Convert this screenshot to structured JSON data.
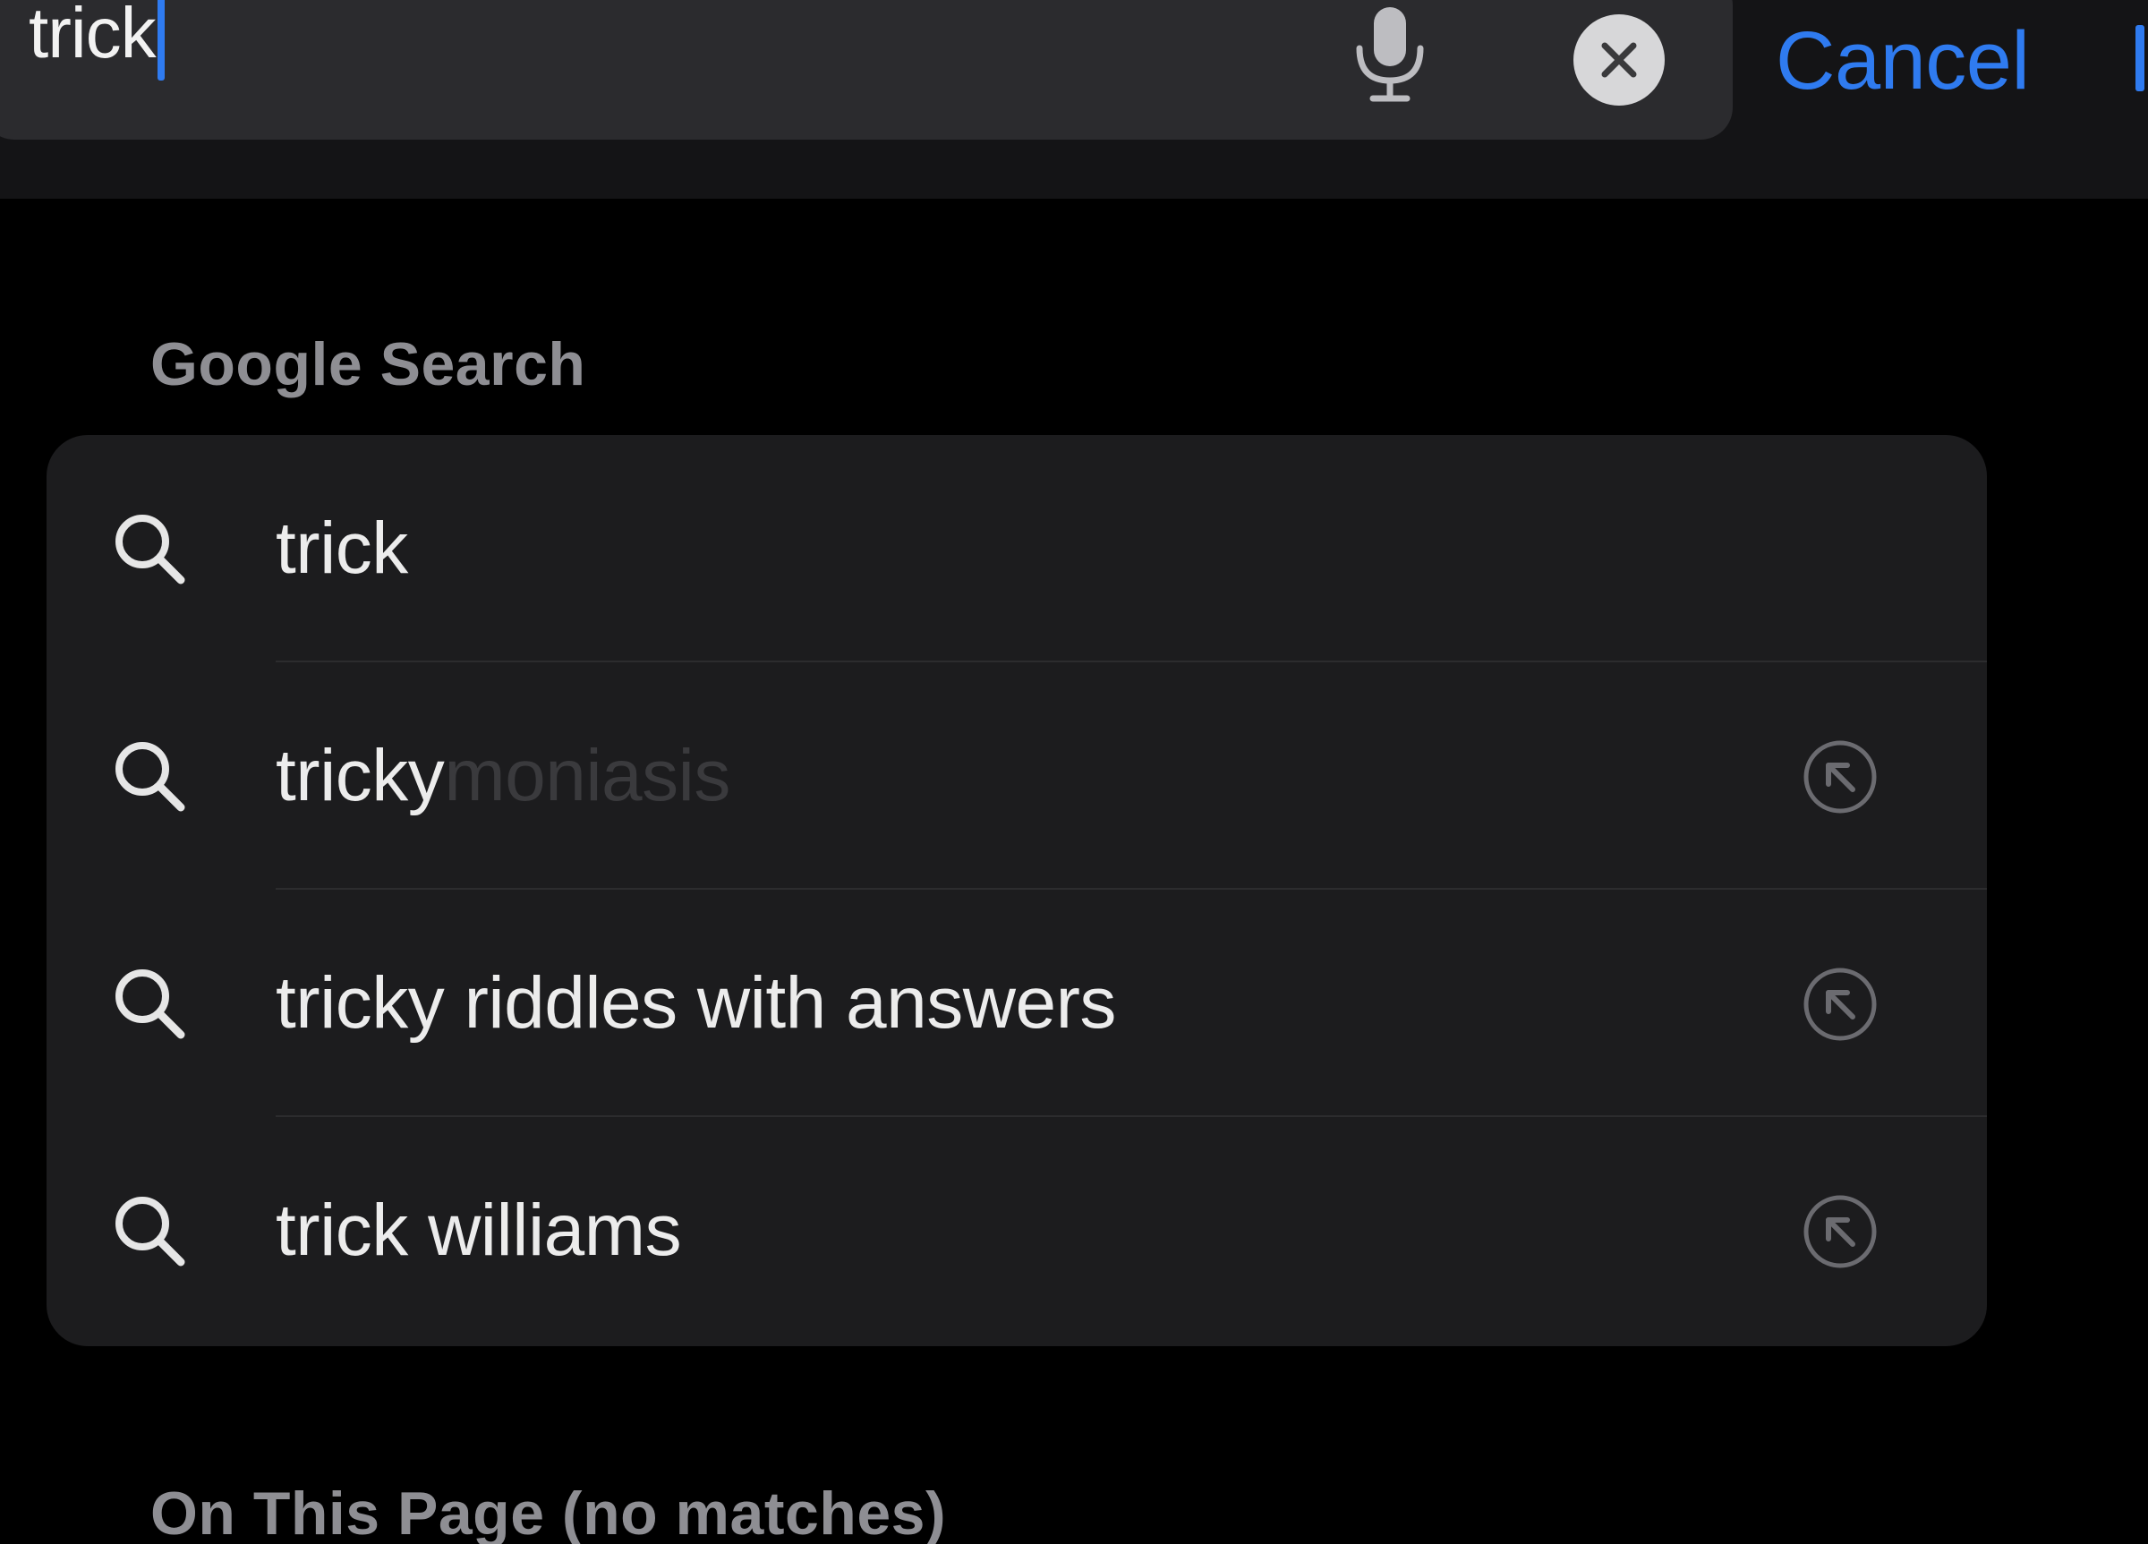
{
  "search": {
    "query": "trick",
    "cancel_label": "Cancel"
  },
  "icons": {
    "microphone": "microphone-icon",
    "clear": "clear-icon",
    "search": "search-icon",
    "fill_arrow": "arrow-up-left-icon"
  },
  "colors": {
    "accent": "#2f7bf0",
    "background": "#000000",
    "card": "#1c1c1e",
    "field": "#2b2b2e",
    "header_text": "#8e8e93"
  },
  "sections": {
    "google_search": "Google Search",
    "on_this_page": "On This Page (no matches)"
  },
  "suggestions": [
    {
      "text": "trick",
      "ghost": "",
      "fill_button": false
    },
    {
      "text": "tricky",
      "ghost": "moniasis",
      "fill_button": true
    },
    {
      "text": "tricky riddles with answers",
      "ghost": "",
      "fill_button": true
    },
    {
      "text": "trick williams",
      "ghost": "",
      "fill_button": true
    }
  ]
}
